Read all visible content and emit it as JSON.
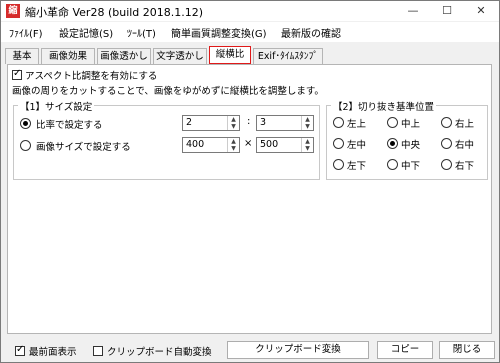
{
  "window": {
    "title": "縮小革命 Ver28 (build 2018.1.12)",
    "icon_label": "縮",
    "minimize": "—",
    "maximize": "☐",
    "close": "✕"
  },
  "menu": [
    "ﾌｧｲﾙ(F)",
    "設定記憶(S)",
    "ﾂｰﾙ(T)",
    "簡単画質調整変換(G)",
    "最新版の確認"
  ],
  "tabs": [
    "基本",
    "画像効果",
    "画像透かし",
    "文字透かし",
    "縦横比",
    "Exif･ﾀｲﾑｽﾀﾝﾌﾟ"
  ],
  "active_tab_index": 4,
  "aspect": {
    "enable_label": "アスペクト比調整を有効にする",
    "enable_checked": true,
    "description": "画像の周りをカットすることで、画像をゆがめずに縦横比を調整します。"
  },
  "size_group": {
    "title": "【1】サイズ設定",
    "ratio_label": "比率で設定する",
    "ratio_selected": true,
    "ratio_w": "2",
    "ratio_h": "3",
    "ratio_sep": ":",
    "size_label": "画像サイズで設定する",
    "size_selected": false,
    "size_w": "400",
    "size_h": "500",
    "size_sep": "×"
  },
  "crop_group": {
    "title": "【2】切り抜き基準位置",
    "options": [
      "左上",
      "中上",
      "右上",
      "左中",
      "中央",
      "右中",
      "左下",
      "中下",
      "右下"
    ],
    "selected_index": 4
  },
  "bottom": {
    "topmost_label": "最前面表示",
    "topmost_checked": true,
    "clipboard_auto_label": "クリップボード自動変換",
    "clipboard_auto_checked": false,
    "clipboard_convert_button": "クリップボード変換",
    "copy_button": "コピー",
    "close_button": "閉じる"
  }
}
